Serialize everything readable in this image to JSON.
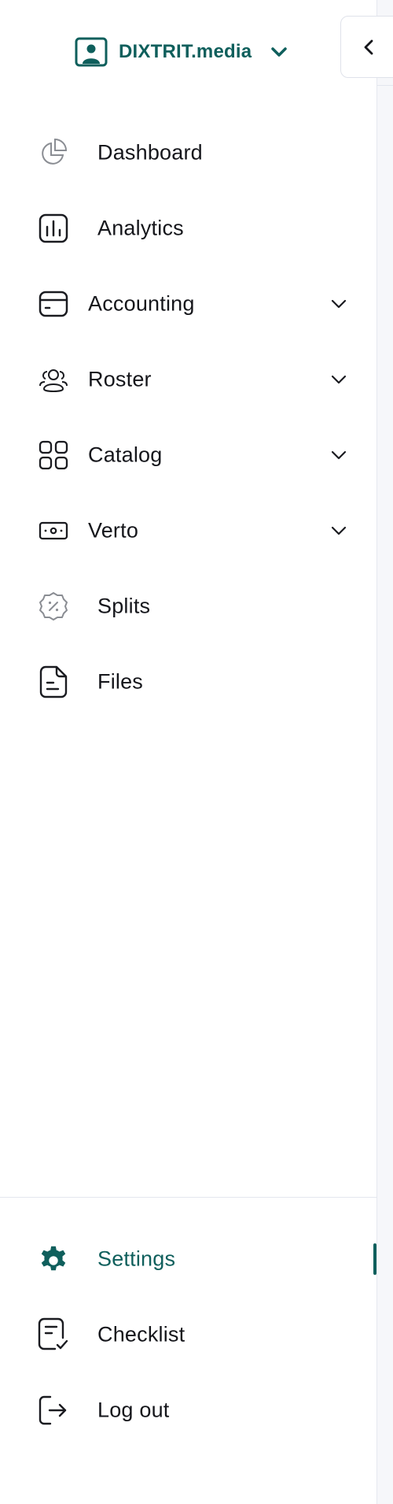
{
  "workspace": {
    "name": "DIXTRIT.media"
  },
  "nav": {
    "dashboard": "Dashboard",
    "analytics": "Analytics",
    "accounting": "Accounting",
    "roster": "Roster",
    "catalog": "Catalog",
    "verto": "Verto",
    "splits": "Splits",
    "files": "Files"
  },
  "footer": {
    "settings": "Settings",
    "checklist": "Checklist",
    "logout": "Log out"
  },
  "icons": {
    "workspace": "user-card-icon",
    "dashboard": "pie-chart-icon",
    "analytics": "bar-chart-icon",
    "accounting": "credit-card-icon",
    "roster": "users-icon",
    "catalog": "grid-icon",
    "verto": "cash-icon",
    "splits": "percent-badge-icon",
    "files": "document-icon",
    "settings": "gear-icon",
    "checklist": "checklist-icon",
    "logout": "logout-icon"
  },
  "colors": {
    "accent": "#0f5f5c",
    "text": "#15161b",
    "muted": "#8a8d93"
  }
}
